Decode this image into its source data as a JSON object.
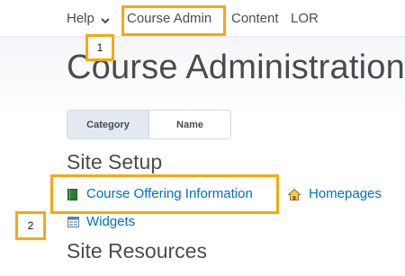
{
  "nav": {
    "items": [
      {
        "label": "Help"
      },
      {
        "label": "Course Admin"
      },
      {
        "label": "Content"
      },
      {
        "label": "LOR"
      }
    ]
  },
  "page": {
    "title": "Course Administration"
  },
  "view_toggle": {
    "options": [
      "Category",
      "Name"
    ],
    "selected": "Category"
  },
  "sections": [
    {
      "title": "Site Setup",
      "tools": [
        {
          "label": "Course Offering Information",
          "icon": "book-icon"
        },
        {
          "label": "Homepages",
          "icon": "home-icon"
        },
        {
          "label": "Widgets",
          "icon": "widgets-icon"
        }
      ]
    },
    {
      "title": "Site Resources",
      "tools": []
    }
  ],
  "annotations": {
    "callouts": [
      "1",
      "2"
    ],
    "color": "#f5a90f"
  },
  "colors": {
    "link": "#006fbf",
    "text": "#494c4e",
    "highlight": "#f5a90f"
  }
}
